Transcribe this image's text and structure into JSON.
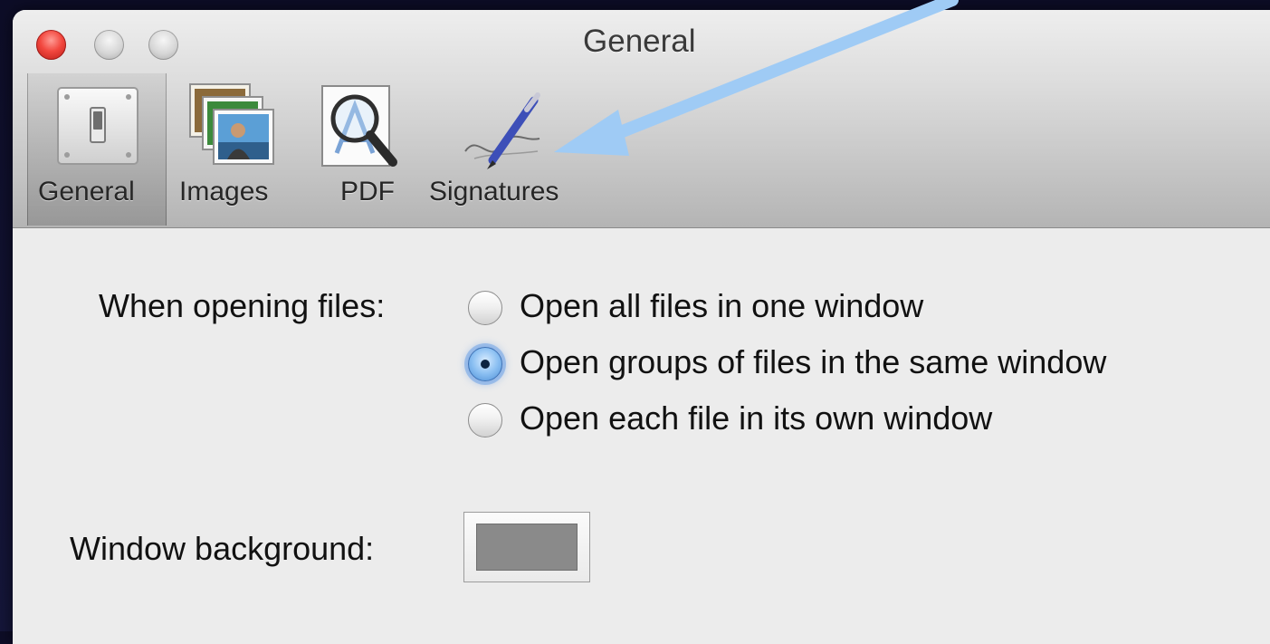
{
  "window": {
    "title": "General"
  },
  "toolbar": {
    "items": [
      {
        "label": "General",
        "icon": "general-switch-icon",
        "selected": true
      },
      {
        "label": "Images",
        "icon": "images-stack-icon",
        "selected": false
      },
      {
        "label": "PDF",
        "icon": "pdf-magnifier-icon",
        "selected": false
      },
      {
        "label": "Signatures",
        "icon": "signature-pen-icon",
        "selected": false
      }
    ]
  },
  "general": {
    "opening_label": "When opening files:",
    "options": [
      {
        "label": "Open all files in one window",
        "selected": false
      },
      {
        "label": "Open groups of files in the same window",
        "selected": true
      },
      {
        "label": "Open each file in its own window",
        "selected": false
      }
    ],
    "background_label": "Window background:",
    "background_color": "#8a8a8a"
  },
  "annotation": {
    "arrow_color": "#9fcbf5",
    "points_to": "Signatures"
  }
}
